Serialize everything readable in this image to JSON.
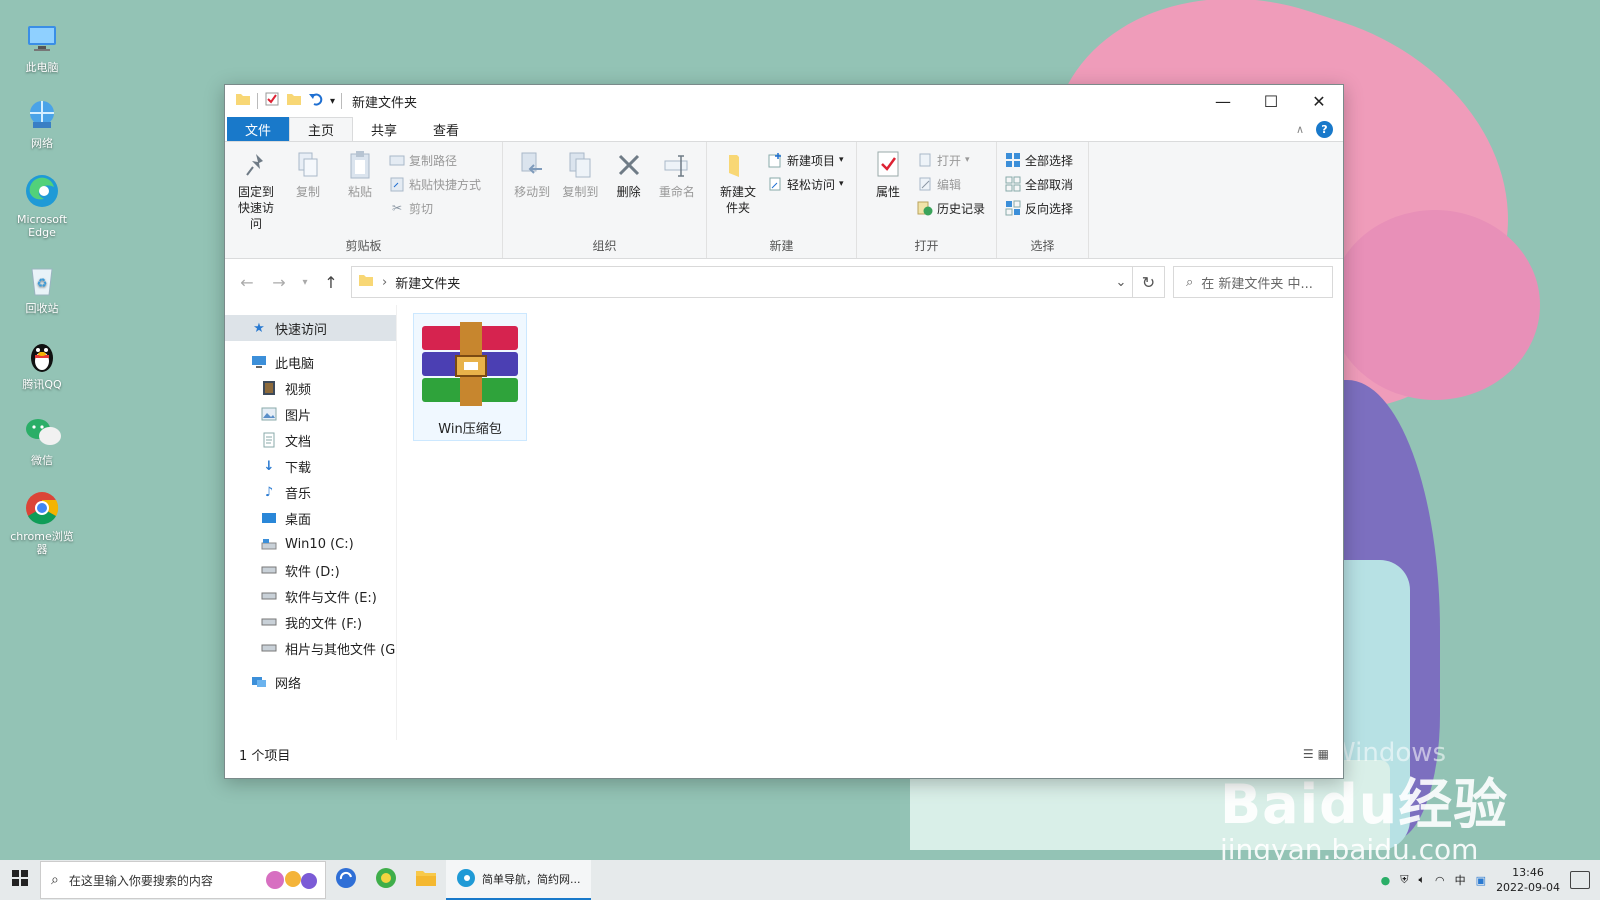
{
  "desktop": {
    "icons": [
      {
        "name": "this-pc",
        "label": "此电脑"
      },
      {
        "name": "network",
        "label": "网络"
      },
      {
        "name": "edge",
        "label": "Microsoft Edge"
      },
      {
        "name": "recycle-bin",
        "label": "回收站"
      },
      {
        "name": "qq",
        "label": "腾讯QQ"
      },
      {
        "name": "wechat",
        "label": "微信"
      },
      {
        "name": "chrome",
        "label": "chrome浏览器"
      }
    ],
    "watermark": {
      "brand": "Baidu经验",
      "url": "jingyan.baidu.com",
      "faint": "Windows"
    }
  },
  "window": {
    "title": "新建文件夹",
    "tabs": {
      "file": "文件",
      "home": "主页",
      "share": "共享",
      "view": "查看"
    },
    "ribbon": {
      "clipboard": {
        "label": "剪贴板",
        "pin": "固定到快速访问",
        "copy": "复制",
        "paste": "粘贴",
        "copy_path": "复制路径",
        "paste_shortcut": "粘贴快捷方式",
        "cut": "剪切"
      },
      "organize": {
        "label": "组织",
        "move_to": "移动到",
        "copy_to": "复制到",
        "delete": "删除",
        "rename": "重命名"
      },
      "new": {
        "label": "新建",
        "new_folder": "新建文件夹",
        "new_item": "新建项目",
        "easy_access": "轻松访问"
      },
      "open": {
        "label": "打开",
        "properties": "属性",
        "open": "打开",
        "edit": "编辑",
        "history": "历史记录"
      },
      "select": {
        "label": "选择",
        "select_all": "全部选择",
        "select_none": "全部取消",
        "invert": "反向选择"
      }
    },
    "address": {
      "path": "新建文件夹",
      "search_placeholder": "在 新建文件夹 中..."
    },
    "nav": {
      "quick_access": "快速访问",
      "this_pc": "此电脑",
      "items": [
        "视频",
        "图片",
        "文档",
        "下载",
        "音乐",
        "桌面",
        "Win10 (C:)",
        "软件 (D:)",
        "软件与文件 (E:)",
        "我的文件 (F:)",
        "相片与其他文件 (G:"
      ],
      "network": "网络"
    },
    "files": [
      {
        "name": "Win压缩包"
      }
    ],
    "status": "1 个项目"
  },
  "taskbar": {
    "search_placeholder": "在这里输入你要搜索的内容",
    "edge_tab": "简单导航，简约网...",
    "time": "13:46",
    "date": "2022-09-04"
  },
  "colors": {
    "accent": "#1979ca",
    "desktop": "#93c3b5"
  }
}
